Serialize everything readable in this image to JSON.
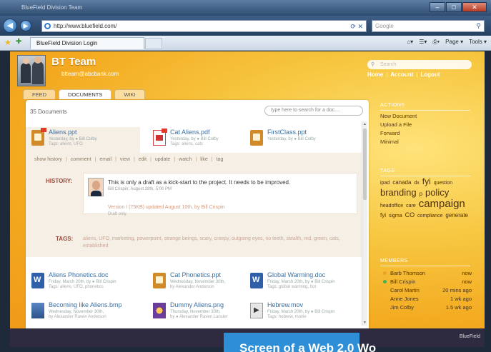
{
  "browser": {
    "window_title": "BlueField Division Team",
    "url": "http://www.bluefield.com/",
    "search_placeholder": "Google",
    "tab_title": "BlueField Division Login",
    "cmd_page": "Page ▾",
    "cmd_tools": "Tools ▾"
  },
  "header": {
    "team_name": "BT Team",
    "email": "btteam@abcbank.com",
    "search_placeholder": "Search",
    "links": {
      "home": "Home",
      "account": "Account",
      "logout": "Logout"
    }
  },
  "tabs": [
    "FEED",
    "DOCUMENTS",
    "WIKI"
  ],
  "documents": {
    "count_label": "35 Documents",
    "search_placeholder": "type here to search for a doc....",
    "items": [
      {
        "name": "Aliens.ppt",
        "meta": "Yesterday, by ● Bill Colby",
        "tags": "Tags: aliens, UFO",
        "type": "ppt"
      },
      {
        "name": "Cat Aliens.pdf",
        "meta": "Yesterday, by ● Bill Colby",
        "tags": "Tags: aliens, cats",
        "type": "pdf"
      },
      {
        "name": "FirstClass.ppt",
        "meta": "Yesterday, by ● Bill Colby",
        "tags": "",
        "type": "ppt"
      },
      {
        "name": "Aliens Phonetics.doc",
        "meta": "Friday, March 20th, by ● Bill Crispin",
        "tags": "Tags: aliens, UFO, phonetics",
        "type": "doc"
      },
      {
        "name": "Cat Phonetics.ppt",
        "meta": "Wednesday, November 30th,",
        "tags": "by Alexander Anderson",
        "type": "ppt"
      },
      {
        "name": "Global Warming.doc",
        "meta": "Friday, March 20th, by ● Bill Crispin",
        "tags": "Tags: global warming, hot",
        "type": "doc"
      },
      {
        "name": "Becoming like Aliens.bmp",
        "meta": "Wednesday, November 30th,",
        "tags": "by Alexander Raven Anderson",
        "type": "bmp"
      },
      {
        "name": "Dummy Aliens.png",
        "meta": "Thursday, November 30th,",
        "tags": "by ● Alexander Raven Lanster",
        "type": "png"
      },
      {
        "name": "Hebrew.mov",
        "meta": "Friday, March 20th, by ● Bill Crispin",
        "tags": "Tags: hebrew, movie",
        "type": "mov"
      }
    ],
    "actions": [
      "show history",
      "comment",
      "email",
      "view",
      "edit",
      "update",
      "watch",
      "like",
      "tag"
    ],
    "history": {
      "label": "HISTORY:",
      "comment": "This is only a draft as a kick-start to the project. It needs to be improved.",
      "comment_meta": "Bill Crispin, August 28th, 5:00 PM",
      "version": "Version I (75KB) updated August 10th, by Bill Crispin",
      "version_meta": "Draft only."
    },
    "tags_section": {
      "label": "TAGS:",
      "text": "aliens, UFO, marketing, powerpoint, strange beings, scary, creepy, outgoing eyes, no teeth, stealth, red, green, cats, established"
    }
  },
  "sidebar": {
    "actions_title": "ACTIONS",
    "actions": [
      "New Document",
      "Upload a File",
      "Forward",
      "Minimal"
    ],
    "tags_title": "TAGS",
    "tag_cloud": [
      {
        "t": "ipad",
        "s": 7
      },
      {
        "t": "canada",
        "s": 8
      },
      {
        "t": "dx",
        "s": 7
      },
      {
        "t": "fyi",
        "s": 12
      },
      {
        "t": "question",
        "s": 7
      },
      {
        "t": "branding",
        "s": 13
      },
      {
        "t": "p",
        "s": 8
      },
      {
        "t": "policy",
        "s": 13
      },
      {
        "t": "headoffice",
        "s": 7
      },
      {
        "t": "care",
        "s": 7
      },
      {
        "t": "campaign",
        "s": 15
      },
      {
        "t": "fyi",
        "s": 8
      },
      {
        "t": "sigma",
        "s": 7
      },
      {
        "t": "CO",
        "s": 9
      },
      {
        "t": "compliance",
        "s": 7
      },
      {
        "t": "generate",
        "s": 8
      }
    ],
    "members_title": "MEMBERS",
    "members": [
      {
        "name": "Barb Thomson",
        "when": "now",
        "status": "#e9a12a"
      },
      {
        "name": "Bill Crispin",
        "when": "now",
        "status": "#4caf50"
      },
      {
        "name": "Carol Martin",
        "when": "20 mins ago",
        "status": ""
      },
      {
        "name": "Anne Jones",
        "when": "1 wk ago",
        "status": ""
      },
      {
        "name": "Jim Colby",
        "when": "1.5 wk ago",
        "status": ""
      }
    ]
  },
  "footer": {
    "brand": "BlueField",
    "banner": "Screen of a Web 2.0 Wo"
  }
}
